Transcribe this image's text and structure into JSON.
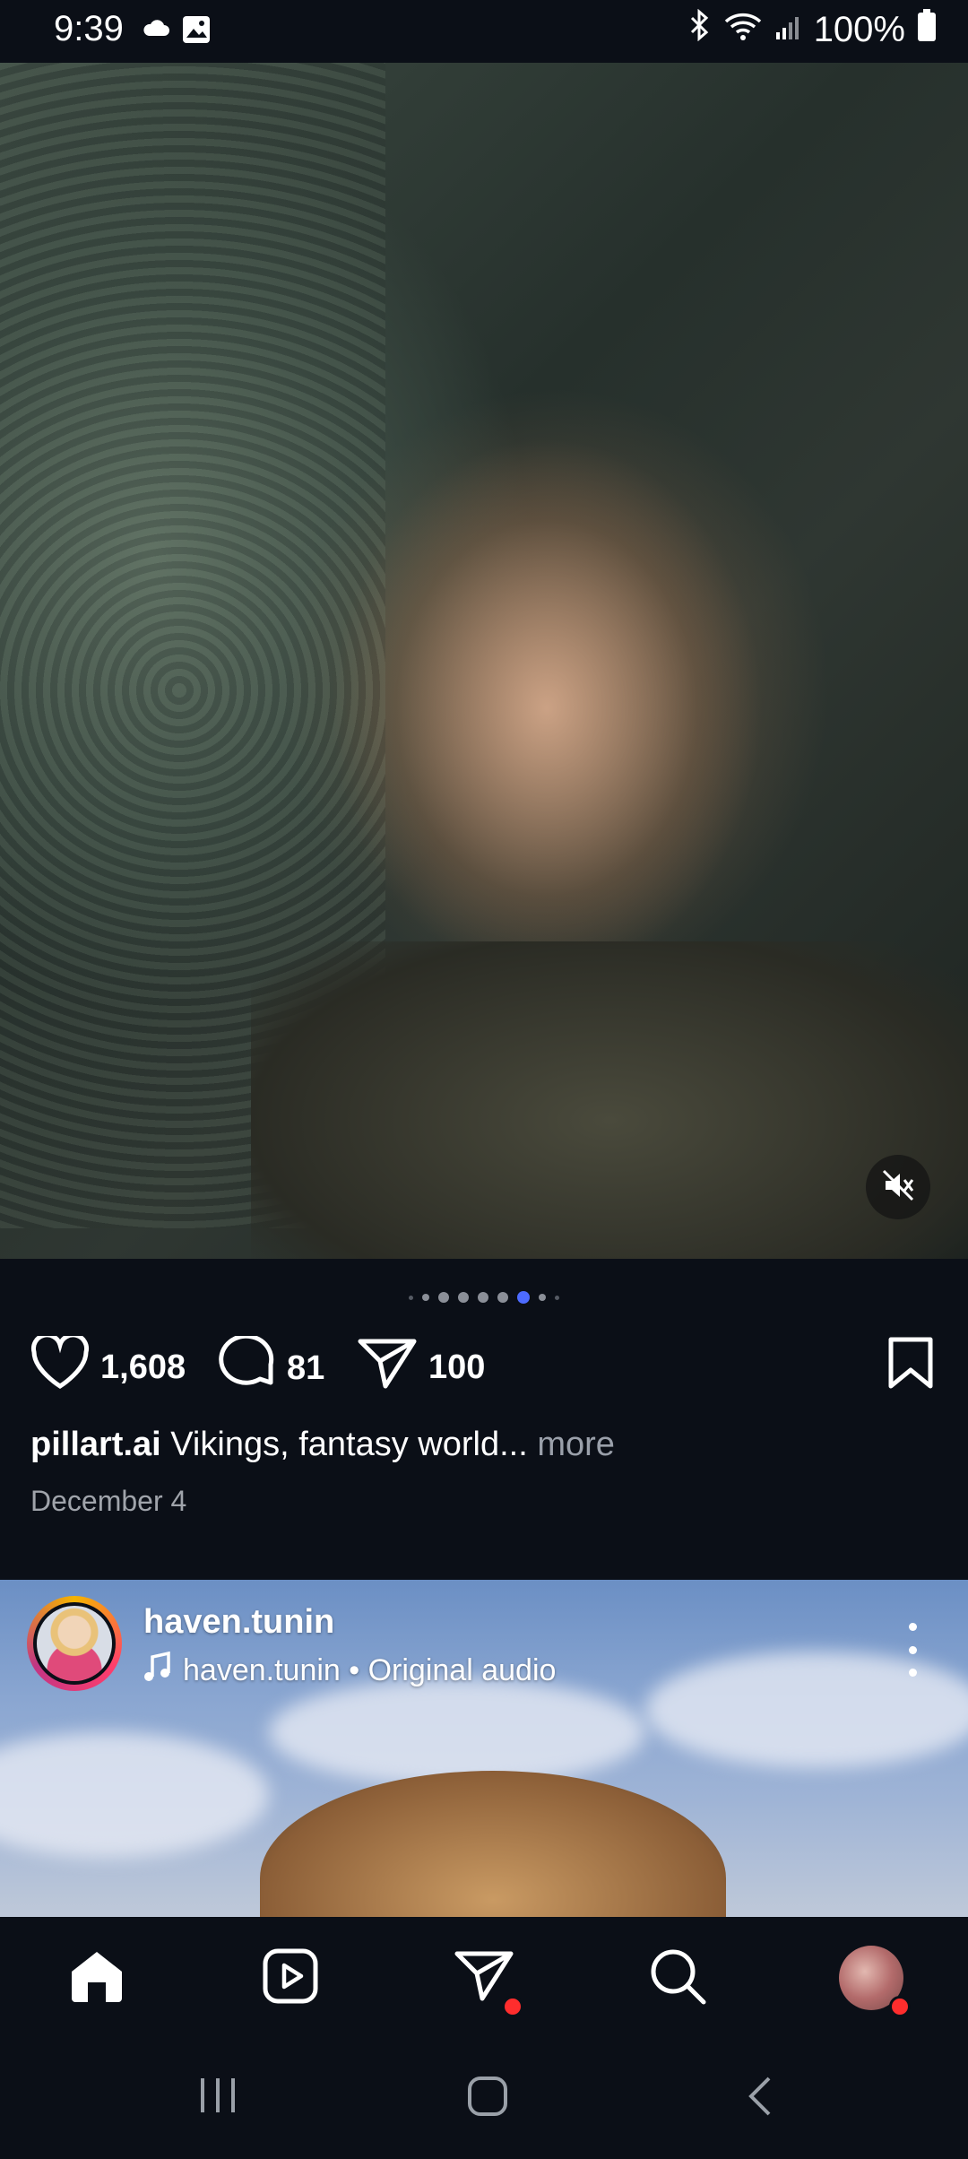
{
  "status_bar": {
    "time": "9:39",
    "battery": "100%"
  },
  "post1": {
    "likes": "1,608",
    "comments": "81",
    "shares": "100",
    "caption_user": "pillart.ai",
    "caption_text": " Vikings, fantasy world...",
    "caption_more": " more",
    "date": "December 4",
    "carousel_total": 8,
    "carousel_active": 6
  },
  "post2": {
    "username": "haven.tunin",
    "audio": "haven.tunin • Original audio"
  },
  "colors": {
    "background": "#0b0f17",
    "accent_dot": "#4d6bff",
    "notification": "#ff2d2d"
  },
  "icons": {
    "status": [
      "cloud-icon",
      "gallery-icon",
      "bluetooth-icon",
      "wifi-icon",
      "signal-icon",
      "battery-icon"
    ],
    "actions": [
      "heart-icon",
      "comment-icon",
      "send-icon",
      "bookmark-icon"
    ],
    "nav": [
      "home-icon",
      "reels-icon",
      "messages-icon",
      "search-icon",
      "profile-avatar"
    ],
    "system": [
      "recents-icon",
      "home-button-icon",
      "back-icon"
    ]
  }
}
